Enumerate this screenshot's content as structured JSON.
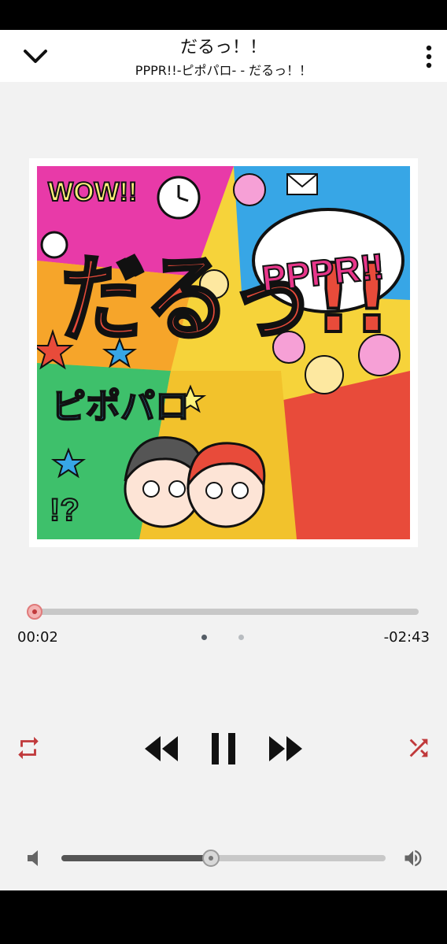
{
  "header": {
    "title": "だるっ！！",
    "subtitle": "PPPR!!-ピポパロ- - だるっ！！"
  },
  "artwork": {
    "texts": [
      "WOW!!",
      "だるっ!!",
      "PPPR!!",
      "ピポパロ",
      "!?"
    ]
  },
  "playback": {
    "elapsed": "00:02",
    "remaining": "-02:43",
    "progress": 0.012,
    "volume": 0.46,
    "page_count": 2,
    "page_active": 0,
    "accent_color": "#c0393b"
  },
  "icons": {
    "back": "chevron-down-icon",
    "menu": "more-vert-icon",
    "repeat": "repeat-icon",
    "rewind": "rewind-icon",
    "pause": "pause-icon",
    "forward": "fast-forward-icon",
    "shuffle": "shuffle-icon",
    "volume_low": "volume-low-icon",
    "volume_high": "volume-high-icon"
  }
}
